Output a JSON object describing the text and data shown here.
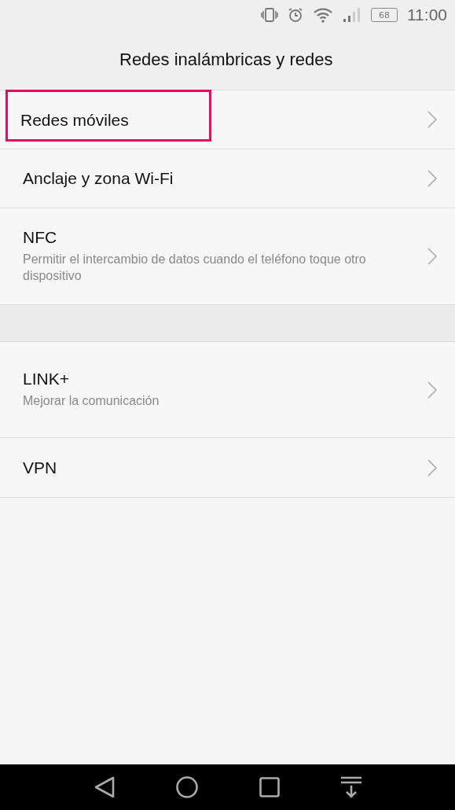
{
  "status_bar": {
    "battery": "68",
    "time": "11:00"
  },
  "header": {
    "title": "Redes inalámbricas y redes"
  },
  "groups": [
    {
      "items": [
        {
          "title": "Redes móviles",
          "highlighted": true
        },
        {
          "title": "Anclaje y zona Wi-Fi",
          "highlighted": false
        },
        {
          "title": "NFC",
          "subtitle": "Permitir el intercambio de datos cuando el teléfono toque otro dispositivo",
          "highlighted": false
        }
      ]
    },
    {
      "items": [
        {
          "title": "LINK+",
          "subtitle": "Mejorar la comunicación",
          "highlighted": false
        },
        {
          "title": "VPN",
          "highlighted": false
        }
      ]
    }
  ]
}
